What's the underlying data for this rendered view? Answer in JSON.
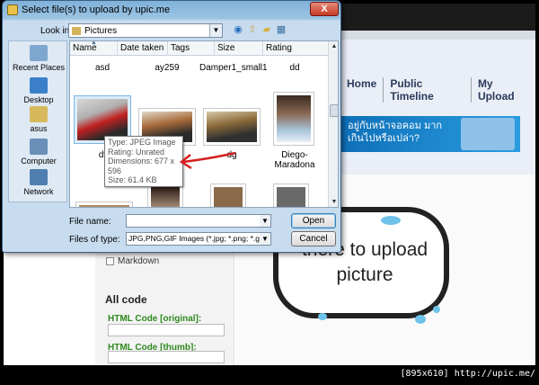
{
  "dialog": {
    "title": "Select file(s) to upload by upic.me",
    "close_label": "X",
    "look_in_label": "Look in:",
    "look_in_value": "Pictures",
    "toolbar_icons": [
      "back-icon",
      "up-folder-icon",
      "new-folder-icon",
      "views-icon"
    ],
    "places": [
      {
        "label": "Recent Places",
        "icon": "recent-places-icon"
      },
      {
        "label": "Desktop",
        "icon": "desktop-icon"
      },
      {
        "label": "asus",
        "icon": "user-folder-icon"
      },
      {
        "label": "Computer",
        "icon": "computer-icon"
      },
      {
        "label": "Network",
        "icon": "network-icon"
      }
    ],
    "columns": [
      "Name",
      "Date taken",
      "Tags",
      "Size",
      "Rating"
    ],
    "top_row_names": [
      "asd",
      "ay259",
      "Damper1_small1",
      "dd"
    ],
    "files": [
      {
        "name": "df",
        "colors": [
          "#c02020",
          "#3a3a3a"
        ]
      },
      {
        "name": "",
        "colors": [
          "#7a4020",
          "#2a2a2a"
        ]
      },
      {
        "name": "dg",
        "colors": [
          "#8a6a3a",
          "#303030"
        ]
      },
      {
        "name": "Diego-Maradona",
        "colors": [
          "#6d5040",
          "#a8c6dc"
        ]
      }
    ],
    "bottom_row_count": 4,
    "tooltip": {
      "type": "Type: JPEG Image",
      "rating": "Rating: Unrated",
      "dimensions": "Dimensions: 677 x 596",
      "size": "Size: 61.4 KB"
    },
    "file_name_label": "File name:",
    "file_name_value": "",
    "files_of_type_label": "Files of type:",
    "files_of_type_value": "JPG,PNG,GIF Images (*.jpg; *.png; *.gif) (*.jpg;*",
    "open_button": "Open",
    "cancel_button": "Cancel"
  },
  "webpage": {
    "nav": [
      "Home",
      "Public Timeline",
      "My Upload"
    ],
    "ad_text": "อยู่กับหน้าจอคอม มากเกินไปหรือเปล่า?",
    "markdown_label": "Markdown",
    "all_code_heading": "All code",
    "html_code_original": "HTML Code [original]:",
    "html_code_thumb": "HTML Code [thumb]:",
    "bubble_text": "there to upload picture"
  },
  "caption": "[895x610] http://upic.me/",
  "colors": {
    "titlebar": "#7fb1d9",
    "close_button": "#c43a23",
    "green_label": "#2e8b1e",
    "arrow": "#d42020"
  }
}
